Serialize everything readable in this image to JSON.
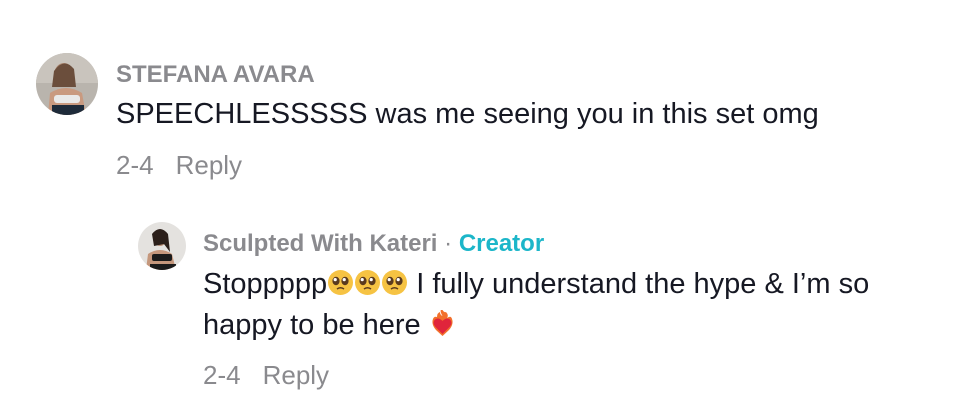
{
  "comments": [
    {
      "author": "STEFANA AVARA",
      "text": "SPEECHLESSSSS was me seeing you in this set omg",
      "date": "2-4",
      "reply_label": "Reply"
    }
  ],
  "reply": {
    "author": "Sculpted With Kateri",
    "separator": "·",
    "creator_label": "Creator",
    "text_part1": "Stoppppp",
    "text_part2": " I fully understand the hype & I’m so",
    "text_part3": "happy to be here",
    "date": "2-4",
    "reply_label": "Reply"
  },
  "icons": {
    "pleading_emoji": "pleading-face-emoji",
    "heart_emoji": "heart-on-fire-emoji"
  },
  "colors": {
    "secondary_text": "#8a8a8e",
    "primary_text": "#161823",
    "creator_accent": "#1cb6c9"
  }
}
